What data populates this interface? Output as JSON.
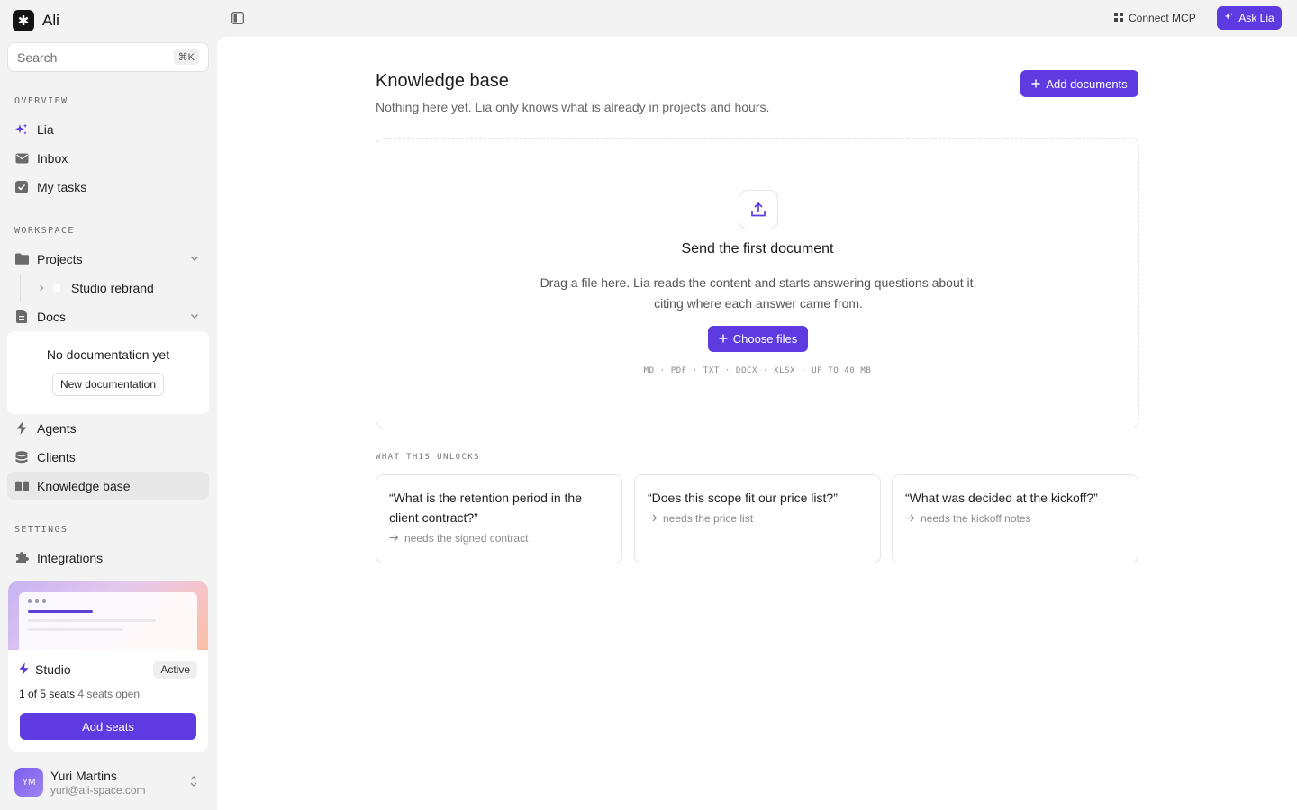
{
  "brand": {
    "name": "Ali",
    "logo_glyph": "✱"
  },
  "search": {
    "placeholder": "Search",
    "shortcut": "⌘K"
  },
  "sidebar": {
    "overview_label": "OVERVIEW",
    "overview_items": [
      {
        "label": "Lia",
        "icon": "sparkle-icon"
      },
      {
        "label": "Inbox",
        "icon": "mail-icon"
      },
      {
        "label": "My tasks",
        "icon": "checkbox-icon"
      }
    ],
    "workspace_label": "WORKSPACE",
    "projects_label": "Projects",
    "project_child": "Studio rebrand",
    "docs_label": "Docs",
    "docs_empty_text": "No documentation yet",
    "docs_empty_button": "New documentation",
    "workspace_items": [
      {
        "label": "Agents",
        "icon": "bolt-icon"
      },
      {
        "label": "Clients",
        "icon": "database-icon"
      },
      {
        "label": "Knowledge base",
        "icon": "book-icon"
      }
    ],
    "settings_label": "SETTINGS",
    "settings_items": [
      {
        "label": "Integrations",
        "icon": "puzzle-icon"
      }
    ]
  },
  "plan": {
    "name": "Studio",
    "status": "Active",
    "seats_used": "1 of 5 seats",
    "seats_open": "4 seats open",
    "button": "Add seats"
  },
  "user": {
    "initials": "YM",
    "name": "Yuri Martins",
    "email": "yuri@ali-space.com"
  },
  "topbar": {
    "connect_label": "Connect MCP",
    "ask_label": "Ask Lia"
  },
  "main": {
    "title": "Knowledge base",
    "subtitle": "Nothing here yet. Lia only knows what is already in projects and hours.",
    "add_button": "Add documents",
    "drop": {
      "heading": "Send the first document",
      "description": "Drag a file here. Lia reads the content and starts answering questions about it, citing where each answer came from.",
      "choose_button": "Choose files",
      "formats": "MD · PDF · TXT · DOCX · XLSX · UP TO 40 MB"
    },
    "unlocks_label": "WHAT THIS UNLOCKS",
    "cards": [
      {
        "question": "“What is the retention period in the client contract?”",
        "need": "needs the signed contract"
      },
      {
        "question": "“Does this scope fit our price list?”",
        "need": "needs the price list"
      },
      {
        "question": "“What was decided at the kickoff?”",
        "need": "needs the kickoff notes"
      }
    ]
  },
  "colors": {
    "accent": "#5d3be0",
    "sidebar_bg": "#f4f3f3",
    "panel_bg": "#ffffff"
  }
}
